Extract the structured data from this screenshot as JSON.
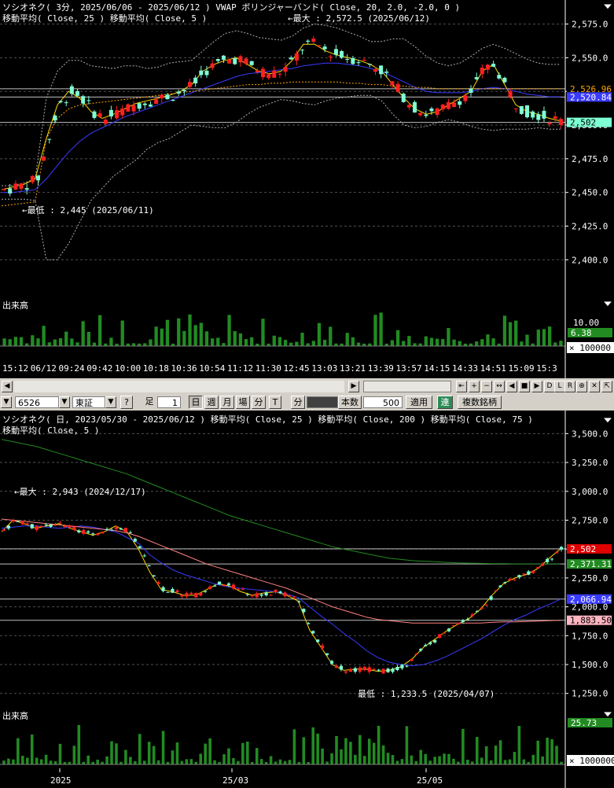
{
  "top_chart": {
    "title_line1": "ソシオネク( 3分, 2025/06/06 - 2025/06/12 )   VWAP   ボリンジャーバンド( Close, 20, 2.0, -2.0, 0 )",
    "title_line2": "移動平均( Close, 25 )   移動平均( Close, 5 )",
    "max_annotation": "←最大 : 2,572.5 (2025/06/12)",
    "min_annotation": "←最低 : 2,445 (2025/06/11)",
    "price_ticks": [
      "2,575.0",
      "2,550.0",
      "2,525.0",
      "2,500.0",
      "2,475.0",
      "2,450.0",
      "2,425.0",
      "2,400.0"
    ],
    "price_tick_values": [
      2575,
      2550,
      2525,
      2500,
      2475,
      2450,
      2425,
      2400
    ],
    "price_tags": [
      {
        "label": "2,526.96",
        "value": 2526.96,
        "bg": "#000000",
        "fg": "#ffa500"
      },
      {
        "label": "2,520.84",
        "value": 2520.84,
        "bg": "#3a3aff",
        "fg": "#ffffff"
      },
      {
        "label": "2,502",
        "value": 2502,
        "bg": "#7fffd4",
        "fg": "#000000"
      }
    ],
    "volume_label": "出来高",
    "volume_value": "6.38",
    "volume_unit": "× 100000",
    "volume_tick": "10.00",
    "time_labels": [
      "15:12",
      "06/12",
      "09:24",
      "09:42",
      "10:00",
      "10:18",
      "10:36",
      "10:54",
      "11:12",
      "11:30",
      "12:45",
      "13:03",
      "13:21",
      "13:39",
      "13:57",
      "14:15",
      "14:33",
      "14:51",
      "15:09",
      "15:3"
    ]
  },
  "toolbar": {
    "code": "6526",
    "market": "東証",
    "help": "?",
    "ashi": "足",
    "interval": "1",
    "day": "日",
    "week": "週",
    "month": "月",
    "ba": "場",
    "minute_btn": "分",
    "tick": "T",
    "minute_label": "分",
    "honsu": "本数",
    "count": "500",
    "apply": "適用",
    "ren": "連",
    "multi": "複数銘柄"
  },
  "bottom_chart": {
    "title_line1": "ソシオネク( 日, 2023/05/30 - 2025/06/12 )   移動平均( Close, 25 )   移動平均( Close, 200 )   移動平均( Close, 75 )",
    "title_line2": "移動平均( Close, 5 )",
    "max_annotation": "←最大 : 2,943 (2024/12/17)",
    "min_annotation": "最低 : 1,233.5 (2025/04/07)",
    "price_ticks": [
      "3,500.0",
      "3,250.0",
      "3,000.0",
      "2,750.0",
      "2,500.0",
      "2,250.0",
      "2,000.0",
      "1,750.0",
      "1,500.0",
      "1,250.0"
    ],
    "price_tick_values": [
      3500,
      3250,
      3000,
      2750,
      2500,
      2250,
      2000,
      1750,
      1500,
      1250
    ],
    "price_tags": [
      {
        "label": "2,502",
        "value": 2502,
        "bg": "#e00000",
        "fg": "#ffffff"
      },
      {
        "label": "2,371.31",
        "value": 2371.31,
        "bg": "#228b22",
        "fg": "#ffffff"
      },
      {
        "label": "2,066.94",
        "value": 2066.94,
        "bg": "#3a3aff",
        "fg": "#ffffff"
      },
      {
        "label": "1,883.50",
        "value": 1883.5,
        "bg": "#ffb6c1",
        "fg": "#000000"
      }
    ],
    "volume_label": "出来高",
    "volume_value": "25.73",
    "volume_unit": "× 1000000",
    "date_labels": [
      "2025",
      "25/03",
      "25/05"
    ]
  },
  "colors": {
    "up": "#ff2020",
    "down": "#7fffd4",
    "ma5": "#ffd700",
    "ma25": "#3a3aff",
    "ma75": "#ff8080",
    "ma200": "#228b22",
    "vwap": "#ffa500",
    "volume": "#228b22",
    "grid": "#505050"
  },
  "chart_data": [
    {
      "type": "candlestick",
      "title": "ソシオネク( 3分, 2025/06/06 - 2025/06/12 )",
      "ylim": [
        2385,
        2585
      ],
      "series": [
        {
          "name": "移動平均( Close, 5 )",
          "values": [
            2452,
            2454,
            2456,
            2460,
            2490,
            2515,
            2525,
            2520,
            2510,
            2505,
            2508,
            2512,
            2516,
            2518,
            2520,
            2522,
            2525,
            2530,
            2540,
            2545,
            2548,
            2550,
            2545,
            2540,
            2538,
            2540,
            2548,
            2560,
            2560,
            2555,
            2552,
            2550,
            2548,
            2545,
            2540,
            2530,
            2520,
            2512,
            2508,
            2510,
            2515,
            2520,
            2525,
            2540,
            2545,
            2530,
            2515,
            2510,
            2508,
            2505,
            2503
          ]
        },
        {
          "name": "移動平均( Close, 25 )",
          "values": [
            2450,
            2450,
            2451,
            2452,
            2460,
            2470,
            2480,
            2488,
            2494,
            2498,
            2502,
            2506,
            2509,
            2512,
            2515,
            2518,
            2521,
            2524,
            2527,
            2530,
            2533,
            2536,
            2538,
            2539,
            2540,
            2541,
            2542,
            2544,
            2545,
            2546,
            2546,
            2545,
            2544,
            2542,
            2540,
            2536,
            2532,
            2528,
            2525,
            2524,
            2524,
            2524,
            2525,
            2527,
            2528,
            2527,
            2525,
            2523,
            2522,
            2521,
            2521
          ]
        },
        {
          "name": "VWAP",
          "values": [
            2440,
            2441,
            2442,
            2443,
            2490,
            2505,
            2512,
            2515,
            2516,
            2517,
            2518,
            2519,
            2520,
            2521,
            2522,
            2523,
            2524,
            2525,
            2526,
            2527,
            2528,
            2529,
            2530,
            2530,
            2531,
            2531,
            2532,
            2532,
            2532,
            2532,
            2532,
            2531,
            2531,
            2530,
            2530,
            2529,
            2529,
            2528,
            2528,
            2527,
            2527,
            2527,
            2527,
            2527,
            2527,
            2527,
            2527,
            2527,
            2527,
            2527,
            2527
          ]
        }
      ]
    },
    {
      "type": "candlestick",
      "title": "ソシオネク( 日, 2023/05/30 - 2025/06/12 )",
      "ylim": [
        1150,
        3600
      ],
      "series": [
        {
          "name": "移動平均( Close, 5 )",
          "values": [
            2650,
            2750,
            2720,
            2680,
            2700,
            2720,
            2680,
            2650,
            2620,
            2650,
            2700,
            2650,
            2500,
            2300,
            2150,
            2130,
            2100,
            2100,
            2150,
            2200,
            2180,
            2130,
            2100,
            2120,
            2130,
            2100,
            2050,
            1800,
            1650,
            1500,
            1450,
            1460,
            1460,
            1440,
            1450,
            1480,
            1550,
            1650,
            1720,
            1790,
            1850,
            1900,
            1980,
            2100,
            2200,
            2250,
            2280,
            2330,
            2420,
            2502
          ]
        },
        {
          "name": "移動平均( Close, 25 )",
          "values": [
            2680,
            2690,
            2700,
            2700,
            2690,
            2680,
            2690,
            2700,
            2690,
            2670,
            2650,
            2600,
            2550,
            2450,
            2380,
            2320,
            2280,
            2250,
            2220,
            2190,
            2170,
            2160,
            2150,
            2140,
            2130,
            2110,
            2080,
            2000,
            1920,
            1850,
            1770,
            1700,
            1620,
            1560,
            1520,
            1500,
            1490,
            1500,
            1530,
            1570,
            1620,
            1670,
            1720,
            1780,
            1840,
            1890,
            1930,
            1980,
            2020,
            2066.94
          ]
        },
        {
          "name": "移動平均( Close, 75 )",
          "values": [
            2760,
            2750,
            2740,
            2730,
            2720,
            2710,
            2700,
            2690,
            2680,
            2670,
            2660,
            2640,
            2610,
            2570,
            2530,
            2490,
            2450,
            2410,
            2370,
            2340,
            2310,
            2280,
            2250,
            2220,
            2190,
            2160,
            2120,
            2080,
            2040,
            2000,
            1970,
            1940,
            1910,
            1890,
            1880,
            1870,
            1860,
            1860,
            1860,
            1860,
            1860,
            1860,
            1860,
            1865,
            1870,
            1870,
            1873,
            1876,
            1880,
            1883.5
          ]
        },
        {
          "name": "移動平均( Close, 200 )",
          "values": [
            3450,
            3430,
            3410,
            3390,
            3360,
            3330,
            3300,
            3270,
            3240,
            3210,
            3180,
            3150,
            3110,
            3070,
            3030,
            2990,
            2950,
            2910,
            2870,
            2830,
            2790,
            2760,
            2730,
            2700,
            2670,
            2640,
            2610,
            2580,
            2550,
            2520,
            2500,
            2480,
            2460,
            2440,
            2420,
            2410,
            2400,
            2395,
            2390,
            2385,
            2380,
            2378,
            2376,
            2374,
            2373,
            2372,
            2372,
            2371.5,
            2371.4,
            2371.31
          ]
        }
      ]
    }
  ]
}
